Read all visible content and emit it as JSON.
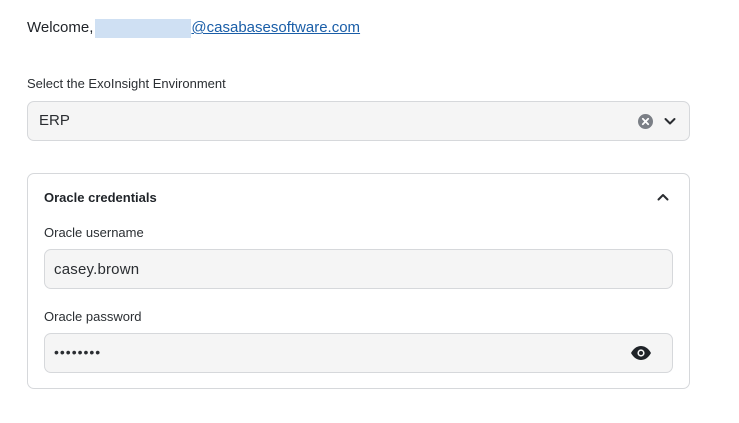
{
  "header": {
    "welcome_text": "Welcome,",
    "email_domain": "@casabasesoftware.com"
  },
  "environment": {
    "label": "Select the ExoInsight Environment",
    "selected_value": "ERP",
    "clear_icon": "clear-circle-icon",
    "dropdown_icon": "chevron-down-icon"
  },
  "credentials": {
    "title": "Oracle credentials",
    "collapse_icon": "chevron-up-icon",
    "username_label": "Oracle username",
    "username_value": "casey.brown",
    "password_label": "Oracle password",
    "password_masked": "••••••••",
    "show_password_icon": "eye-icon"
  },
  "colors": {
    "link": "#1a5ea8",
    "field_background": "#f5f5f5",
    "border": "#d6d8db",
    "redaction": "#cfe0f3"
  }
}
